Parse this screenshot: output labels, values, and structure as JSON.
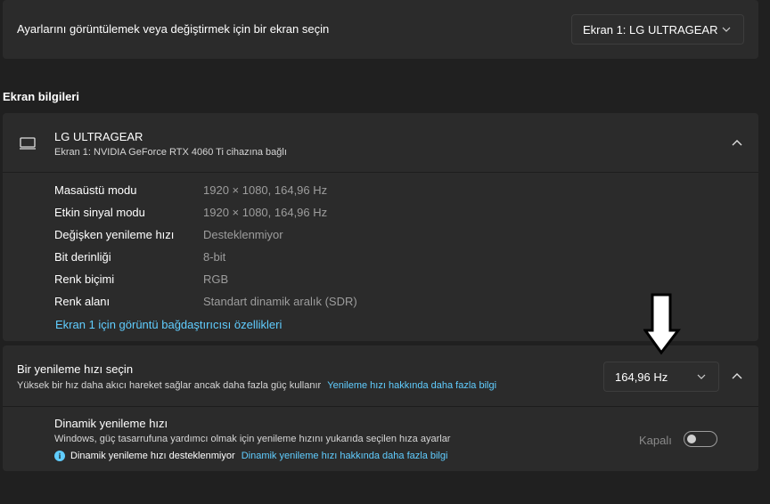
{
  "top_card": {
    "label": "Ayarlarını görüntülemek veya değiştirmek için bir ekran seçin",
    "display_dropdown": {
      "value": "Ekran 1: LG ULTRAGEAR",
      "icon": "chevron-down-icon"
    }
  },
  "section_title": "Ekran bilgileri",
  "display_info": {
    "icon": "monitor-icon",
    "name": "LG ULTRAGEAR",
    "subtitle": "Ekran 1: NVIDIA GeForce RTX 4060 Ti cihazına bağlı",
    "collapse_icon": "chevron-up-icon",
    "rows": [
      {
        "label": "Masaüstü modu",
        "value": "1920 × 1080, 164,96 Hz"
      },
      {
        "label": "Etkin sinyal modu",
        "value": "1920 × 1080, 164,96 Hz"
      },
      {
        "label": "Değişken yenileme hızı",
        "value": "Desteklenmiyor"
      },
      {
        "label": "Bit derinliği",
        "value": "8-bit"
      },
      {
        "label": "Renk biçimi",
        "value": "RGB"
      },
      {
        "label": "Renk alanı",
        "value": "Standart dinamik aralık (SDR)"
      }
    ],
    "adapter_link": "Ekran 1 için görüntü bağdaştırıcısı özellikleri"
  },
  "refresh_rate": {
    "title": "Bir yenileme hızı seçin",
    "description": "Yüksek bir hız daha akıcı hareket sağlar ancak daha fazla güç kullanır",
    "learn_more_link": "Yenileme hızı hakkında daha fazla bilgi",
    "dropdown_value": "164,96 Hz",
    "collapse_icon": "chevron-up-icon",
    "annotation_icon": "down-arrow-annotation-icon"
  },
  "dynamic_refresh": {
    "title": "Dinamik yenileme hızı",
    "description": "Windows, güç tasarrufuna yardımcı olmak için yenileme hızını yukarıda seçilen hıza ayarlar",
    "info_icon": "info-icon",
    "info_glyph": "i",
    "not_supported": "Dinamik yenileme hızı desteklenmiyor",
    "learn_more_link": "Dinamik yenileme hızı hakkında daha fazla bilgi",
    "toggle_label": "Kapalı",
    "toggle_state": "off"
  },
  "colors": {
    "accent": "#60cdff",
    "card": "#2b2b2b",
    "background": "#202020"
  }
}
